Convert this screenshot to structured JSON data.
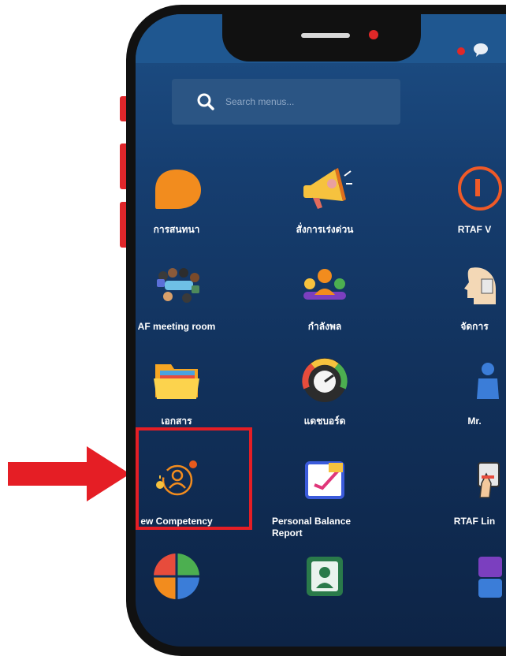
{
  "search": {
    "placeholder": "Search menus..."
  },
  "apps": [
    {
      "label": "การสนทนา",
      "icon": "chat-bubble-icon"
    },
    {
      "label": "สั่งการเร่งด่วน",
      "icon": "megaphone-icon"
    },
    {
      "label": "RTAF V",
      "icon": "rtaf-v-icon"
    },
    {
      "label": "AF meeting room",
      "icon": "meeting-room-icon"
    },
    {
      "label": "กำลังพล",
      "icon": "personnel-icon"
    },
    {
      "label": "จัดการ",
      "icon": "manage-icon"
    },
    {
      "label": "เอกสาร",
      "icon": "folder-icon"
    },
    {
      "label": "แดชบอร์ด",
      "icon": "dashboard-gauge-icon"
    },
    {
      "label": "Mr.",
      "icon": "mr-assistant-icon"
    },
    {
      "label": "ew Competency",
      "icon": "competency-icon"
    },
    {
      "label": "Personal Balance\nReport",
      "icon": "balance-report-icon"
    },
    {
      "label": "RTAF Lin",
      "icon": "rtaf-link-icon"
    },
    {
      "label": "",
      "icon": "color-circle-icon"
    },
    {
      "label": "",
      "icon": "profile-card-icon"
    },
    {
      "label": "",
      "icon": "color-blocks-icon"
    }
  ],
  "colors": {
    "highlight": "#e51e25",
    "arrow": "#e51e25",
    "screen_bg": "#11305a"
  }
}
